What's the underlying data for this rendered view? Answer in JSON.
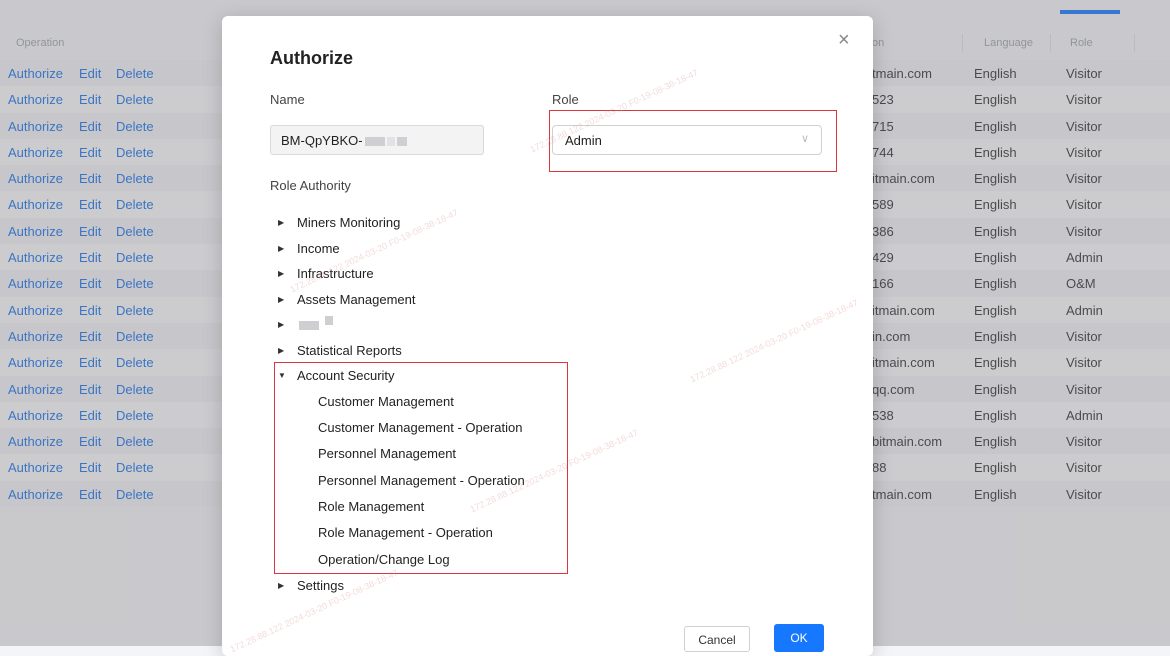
{
  "table": {
    "headers": {
      "operation": "Operation",
      "email_partial": "on",
      "language": "Language",
      "role": "Role"
    },
    "actions": {
      "authorize": "Authorize",
      "edit": "Edit",
      "delete": "Delete"
    },
    "rows": [
      {
        "email": "tmain.com",
        "language": "English",
        "role": "Visitor"
      },
      {
        "email": "523",
        "language": "English",
        "role": "Visitor"
      },
      {
        "email": "715",
        "language": "English",
        "role": "Visitor"
      },
      {
        "email": "744",
        "language": "English",
        "role": "Visitor"
      },
      {
        "email": "itmain.com",
        "language": "English",
        "role": "Visitor"
      },
      {
        "email": "589",
        "language": "English",
        "role": "Visitor"
      },
      {
        "email": "386",
        "language": "English",
        "role": "Visitor"
      },
      {
        "email": "429",
        "language": "English",
        "role": "Admin"
      },
      {
        "email": "166",
        "language": "English",
        "role": "O&M"
      },
      {
        "email": "itmain.com",
        "language": "English",
        "role": "Admin"
      },
      {
        "email": "in.com",
        "language": "English",
        "role": "Visitor"
      },
      {
        "email": "itmain.com",
        "language": "English",
        "role": "Visitor"
      },
      {
        "email": "qq.com",
        "language": "English",
        "role": "Visitor"
      },
      {
        "email": "538",
        "language": "English",
        "role": "Admin"
      },
      {
        "email": "bitmain.com",
        "language": "English",
        "role": "Visitor"
      },
      {
        "email": "88",
        "language": "English",
        "role": "Visitor"
      },
      {
        "email": "tmain.com",
        "language": "English",
        "role": "Visitor"
      }
    ]
  },
  "modal": {
    "title": "Authorize",
    "close_icon": "×",
    "name_label": "Name",
    "name_value": "BM-QpYBKO-",
    "role_label": "Role",
    "role_value": "Admin",
    "role_chevron": "∨",
    "authority_label": "Role Authority",
    "tree": [
      {
        "label": "Miners Monitoring",
        "expanded": false
      },
      {
        "label": "Income",
        "expanded": false
      },
      {
        "label": "Infrastructure",
        "expanded": false
      },
      {
        "label": "Assets Management",
        "expanded": false
      },
      {
        "label": "",
        "expanded": false,
        "redacted": true
      },
      {
        "label": "Statistical Reports",
        "expanded": false
      },
      {
        "label": "Account Security",
        "expanded": true,
        "children": [
          "Customer Management",
          "Customer Management - Operation",
          "Personnel Management",
          "Personnel Management - Operation",
          "Role Management",
          "Role Management - Operation",
          "Operation/Change Log"
        ]
      },
      {
        "label": "Settings",
        "expanded": false
      }
    ],
    "cancel_label": "Cancel",
    "ok_label": "OK",
    "arrow_collapsed": "▶",
    "arrow_expanded": "▼"
  },
  "colors": {
    "link": "#1a73e8",
    "primary": "#1677ff",
    "highlight": "#d9363e"
  },
  "watermark": "172.28.88.122 2024-03-20 F0-19-08-38-18-47"
}
